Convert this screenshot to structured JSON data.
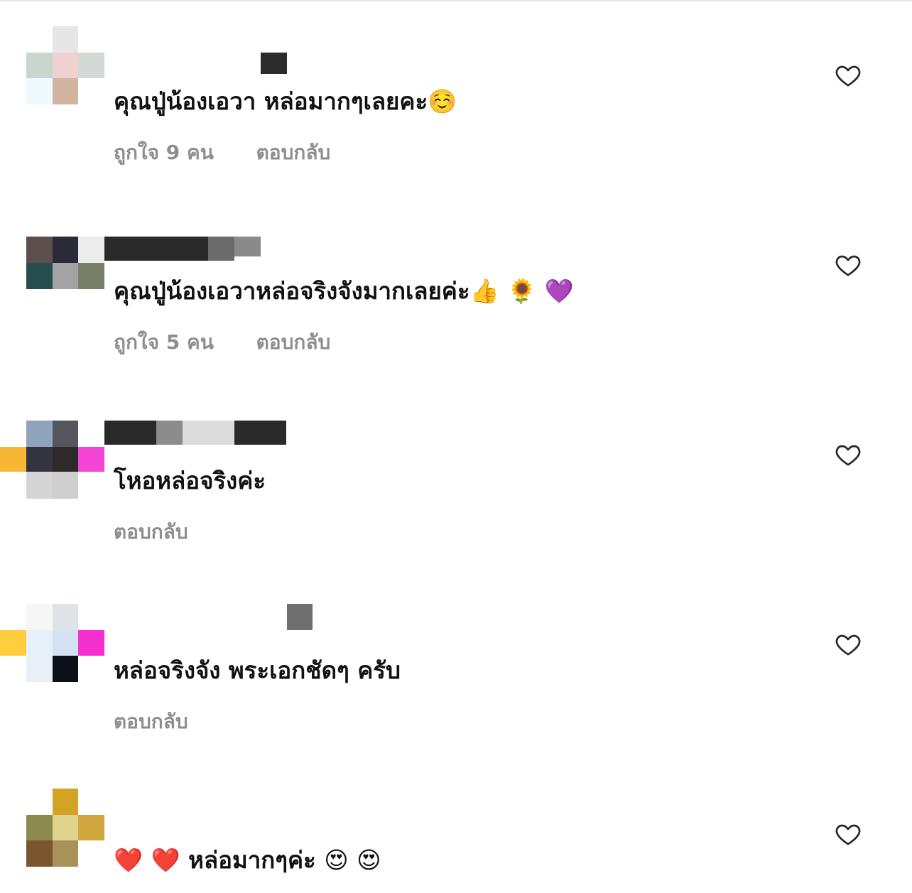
{
  "comments": [
    {
      "text": "คุณปู่น้องเอวา หล่อมากๆเลยคะ☺️",
      "likes_label": "ถูกใจ 9 คน",
      "reply_label": "ตอบกลับ"
    },
    {
      "text": "คุณปู่น้องเอวาหล่อจริงจังมากเลยค่ะ👍 🌻 💜",
      "likes_label": "ถูกใจ 5 คน",
      "reply_label": "ตอบกลับ"
    },
    {
      "text": "โหอหล่อจริงค่ะ",
      "reply_label": "ตอบกลับ"
    },
    {
      "text": "หล่อจริงจัง พระเอกชัดๆ ครับ",
      "reply_label": "ตอบกลับ"
    },
    {
      "text": "❤️ ❤️ หล่อมากๆค่ะ 😍 😍"
    }
  ],
  "colors": {
    "meta_text": "#8e8e8e",
    "heart_outline": "#262626"
  },
  "icons": {
    "like": "heart-outline-icon"
  }
}
